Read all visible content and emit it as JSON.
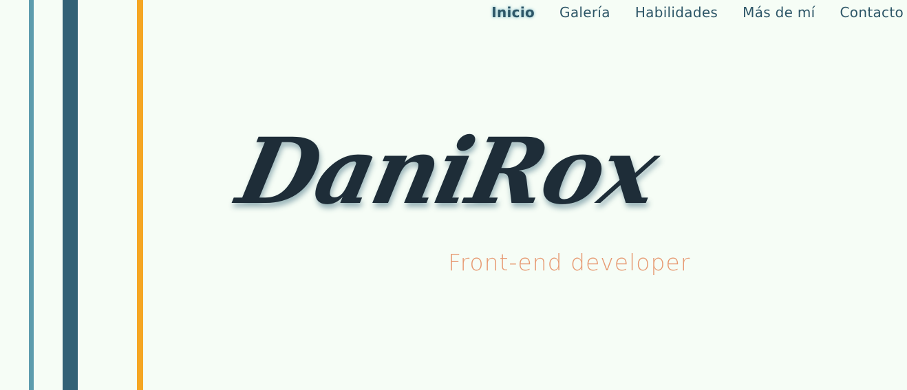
{
  "nav": {
    "items": [
      {
        "label": "Inicio",
        "active": true
      },
      {
        "label": "Galería",
        "active": false
      },
      {
        "label": "Habilidades",
        "active": false
      },
      {
        "label": "Más de mí",
        "active": false
      },
      {
        "label": "Contacto",
        "active": false
      }
    ]
  },
  "hero": {
    "logo_text": "DaniRox",
    "tagline": "Front-end developer"
  },
  "colors": {
    "background": "#f6fdf6",
    "stripe_light": "#5d9cad",
    "stripe_dark": "#336176",
    "stripe_accent": "#f5a623",
    "nav_text": "#2d5667",
    "logo": "#1e2d38",
    "tagline": "#e79a72"
  }
}
